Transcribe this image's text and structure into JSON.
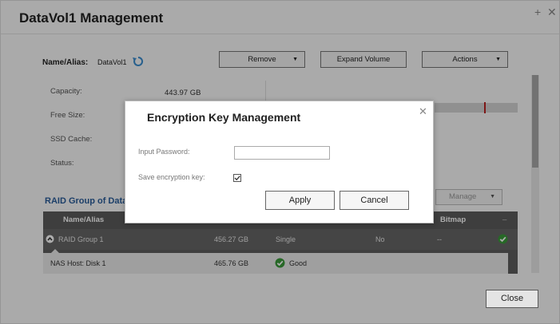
{
  "window": {
    "title": "DataVol1 Management"
  },
  "volume": {
    "name_label": "Name/Alias:",
    "name_value": "DataVol1",
    "fields": [
      {
        "label": "Capacity:",
        "value": "443.97 GB"
      },
      {
        "label": "Free Size:",
        "value": ""
      },
      {
        "label": "SSD Cache:",
        "value": ""
      },
      {
        "label": "Status:",
        "value": ""
      }
    ]
  },
  "toolbar": {
    "remove": "Remove",
    "expand": "Expand Volume",
    "actions": "Actions"
  },
  "raid": {
    "title": "RAID Group of Data",
    "manage": "Manage",
    "columns": [
      "Name/Alias",
      "Bitmap",
      "..."
    ],
    "group_row": {
      "name": "RAID Group 1",
      "capacity": "456.27 GB",
      "type": "Single",
      "bitmap_flag": "No",
      "bitmap": "--"
    },
    "disk_row": {
      "name": "NAS Host: Disk 1",
      "capacity": "465.76 GB",
      "status": "Good"
    }
  },
  "close_label": "Close",
  "dialog": {
    "title": "Encryption Key Management",
    "password_label": "Input Password:",
    "password_value": "",
    "save_label": "Save encryption key:",
    "save_checked": true,
    "apply": "Apply",
    "cancel": "Cancel"
  },
  "colors": {
    "accent": "#2a5d9b",
    "status_good": "#3a9a3a",
    "table_header": "#5c5c5c"
  }
}
